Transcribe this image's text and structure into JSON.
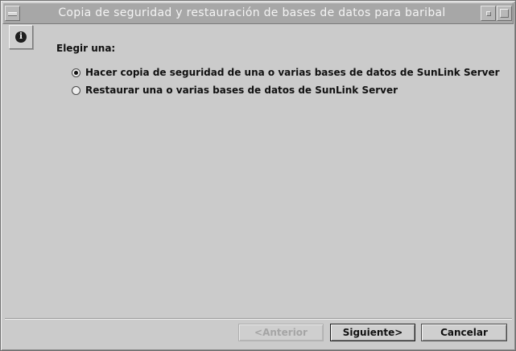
{
  "window": {
    "title": "Copia de seguridad y restauración de bases de datos para baribal"
  },
  "icons": {
    "window_menu": "window-menu-icon",
    "minimize": "minimize-icon",
    "maximize": "maximize-icon",
    "info": "info-icon"
  },
  "info": {
    "glyph": "i"
  },
  "form": {
    "prompt": "Elegir una:",
    "options": [
      {
        "label": "Hacer copia de seguridad de una o varias bases de datos de SunLink Server",
        "selected": true
      },
      {
        "label": "Restaurar una o varias bases de datos de SunLink Server",
        "selected": false
      }
    ]
  },
  "buttons": {
    "previous": "<Anterior",
    "next": "Siguiente>",
    "cancel": "Cancelar"
  },
  "colors": {
    "window_bg": "#cbcbcb",
    "titlebar_bg": "#a7a7a7",
    "title_text": "#f4f4f4",
    "text": "#111111",
    "disabled_text": "#a5a5a5"
  }
}
